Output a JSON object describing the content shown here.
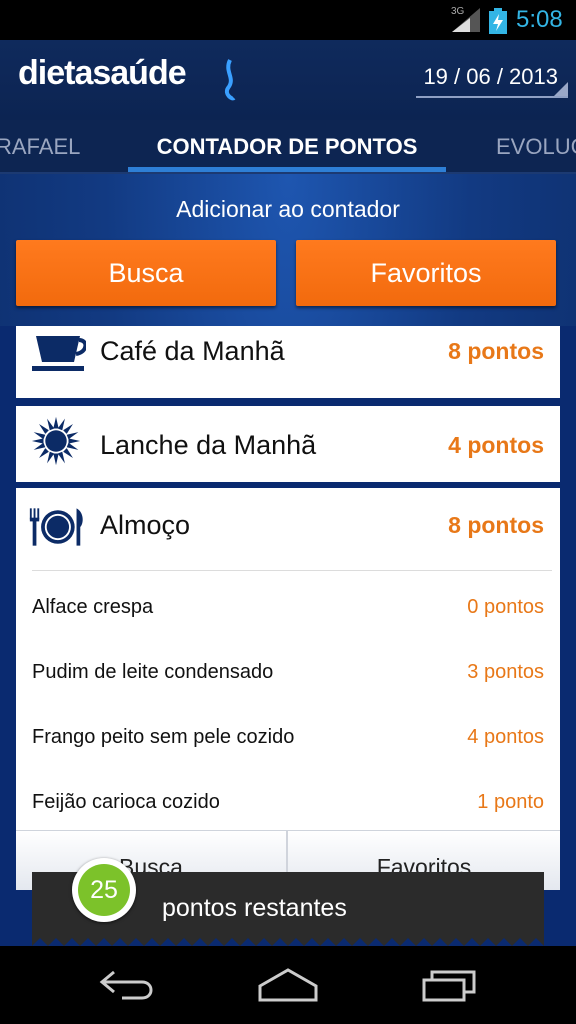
{
  "status_bar": {
    "network": "3G",
    "time": "5:08",
    "signal_icon": "signal-icon",
    "battery_icon": "battery-charging-icon"
  },
  "header": {
    "logo_text_left": "dieta",
    "logo_text_right": "saúde",
    "date": "19 / 06 / 2013"
  },
  "tabs": [
    {
      "label": "RAFAEL"
    },
    {
      "label": "CONTADOR DE PONTOS",
      "selected": true
    },
    {
      "label": "EVOLUÇ"
    }
  ],
  "add_section": {
    "title": "Adicionar ao contador",
    "search_button": "Busca",
    "favorites_button": "Favoritos"
  },
  "meals": [
    {
      "name": "Café da Manhã",
      "points": "8 pontos",
      "icon": "coffee-cup-icon"
    },
    {
      "name": "Lanche da Manhã",
      "points": "4 pontos",
      "icon": "sun-icon"
    },
    {
      "name": "Almoço",
      "points": "8 pontos",
      "icon": "plate-cutlery-icon",
      "items": [
        {
          "name": "Alface crespa",
          "points": "0 pontos"
        },
        {
          "name": "Pudim de leite condensado",
          "points": "3 pontos"
        },
        {
          "name": "Frango peito sem pele cozido",
          "points": "4 pontos"
        },
        {
          "name": "Feijão carioca cozido",
          "points": "1 ponto"
        }
      ],
      "buttons": {
        "search": "Busca",
        "favorites": "Favoritos"
      }
    }
  ],
  "toast": {
    "count": "25",
    "text": "pontos restantes"
  },
  "colors": {
    "accent_orange": "#f26a0d",
    "points_orange": "#e87818",
    "header_blue": "#0d2552",
    "badge_green": "#7cc22a",
    "clock_blue": "#33b5e5"
  }
}
